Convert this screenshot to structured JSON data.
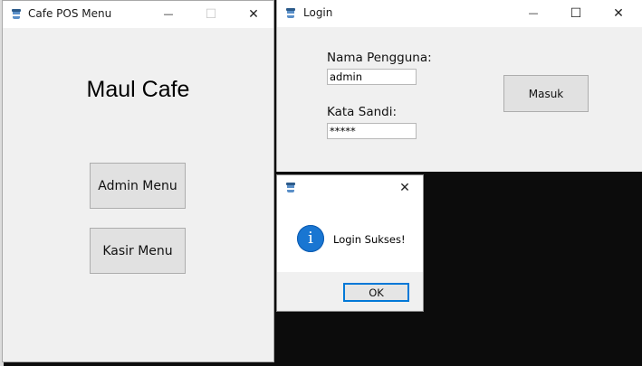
{
  "menu_window": {
    "title": "Cafe POS Menu",
    "heading": "Maul Cafe",
    "admin_button": "Admin Menu",
    "kasir_button": "Kasir Menu",
    "controls": {
      "minimize": "—",
      "maximize": "☐",
      "close": "✕"
    }
  },
  "login_window": {
    "title": "Login",
    "username_label": "Nama Pengguna:",
    "username_value": "admin",
    "password_label": "Kata Sandi:",
    "password_value": "*****",
    "submit_button": "Masuk",
    "controls": {
      "minimize": "—",
      "maximize": "☐",
      "close": "✕"
    }
  },
  "dialog": {
    "message": "Login Sukses!",
    "ok_button": "OK",
    "icon_glyph": "i",
    "close": "✕",
    "icon_name": "info-icon"
  },
  "colors": {
    "info_blue": "#1976d2",
    "dialog_accent": "#0078d7",
    "desktop": "#0c0c0c"
  }
}
